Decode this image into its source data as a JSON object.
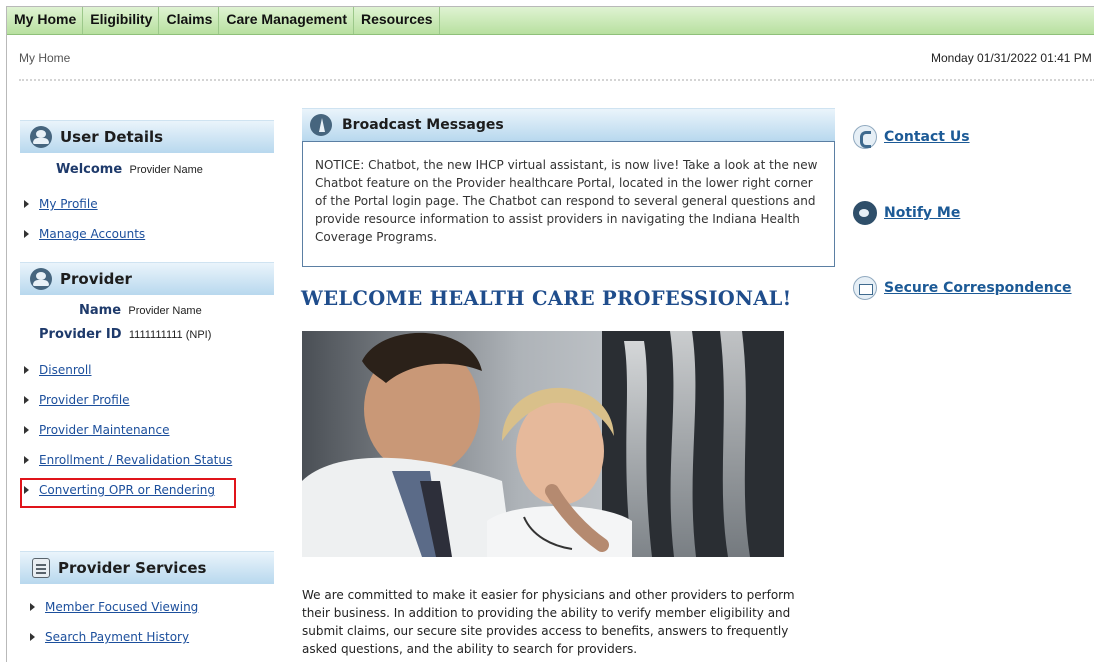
{
  "topnav": {
    "tabs": [
      "My Home",
      "Eligibility",
      "Claims",
      "Care Management",
      "Resources"
    ]
  },
  "header": {
    "breadcrumb": "My Home",
    "datetime": "Monday 01/31/2022 01:41 PM"
  },
  "user_details": {
    "title": "User Details",
    "welcome_label": "Welcome",
    "welcome_value": "Provider Name",
    "links": [
      "My Profile",
      "Manage Accounts"
    ]
  },
  "provider": {
    "title": "Provider",
    "name_label": "Name",
    "name_value": "Provider Name",
    "id_label": "Provider ID",
    "id_value": "1111111111 (NPI)",
    "links": [
      "Disenroll",
      "Provider Profile",
      "Provider Maintenance",
      "Enrollment / Revalidation Status",
      "Converting OPR or Rendering"
    ]
  },
  "provider_services": {
    "title": "Provider Services",
    "links": [
      "Member Focused Viewing",
      "Search Payment History"
    ]
  },
  "broadcast": {
    "title": "Broadcast Messages",
    "message": "NOTICE: Chatbot, the new IHCP virtual assistant, is now live! Take a look at the new Chatbot feature on the Provider healthcare Portal, located in the lower right corner of the Portal login page. The Chatbot can respond to several general questions and provide resource information to assist providers in navigating the Indiana Health Coverage Programs."
  },
  "main": {
    "welcome_heading": "WELCOME HEALTH CARE PROFESSIONAL!",
    "intro": "We are committed to make it easier for physicians and other providers to perform their business. In addition to providing the ability to verify member eligibility and submit claims, our secure site provides access to benefits, answers to frequently asked questions, and the ability to search for providers."
  },
  "right_links": [
    {
      "label": "Contact Us",
      "icon": "phone-icon"
    },
    {
      "label": "Notify Me",
      "icon": "notify-icon"
    },
    {
      "label": "Secure Correspondence",
      "icon": "envelope-icon"
    }
  ],
  "colors": {
    "nav_green": "#b8e0a0",
    "panel_blue": "#b8d8ee",
    "link_blue": "#1c4f9c",
    "heading_blue": "#1f4d8c",
    "highlight_red": "#e0141a"
  }
}
